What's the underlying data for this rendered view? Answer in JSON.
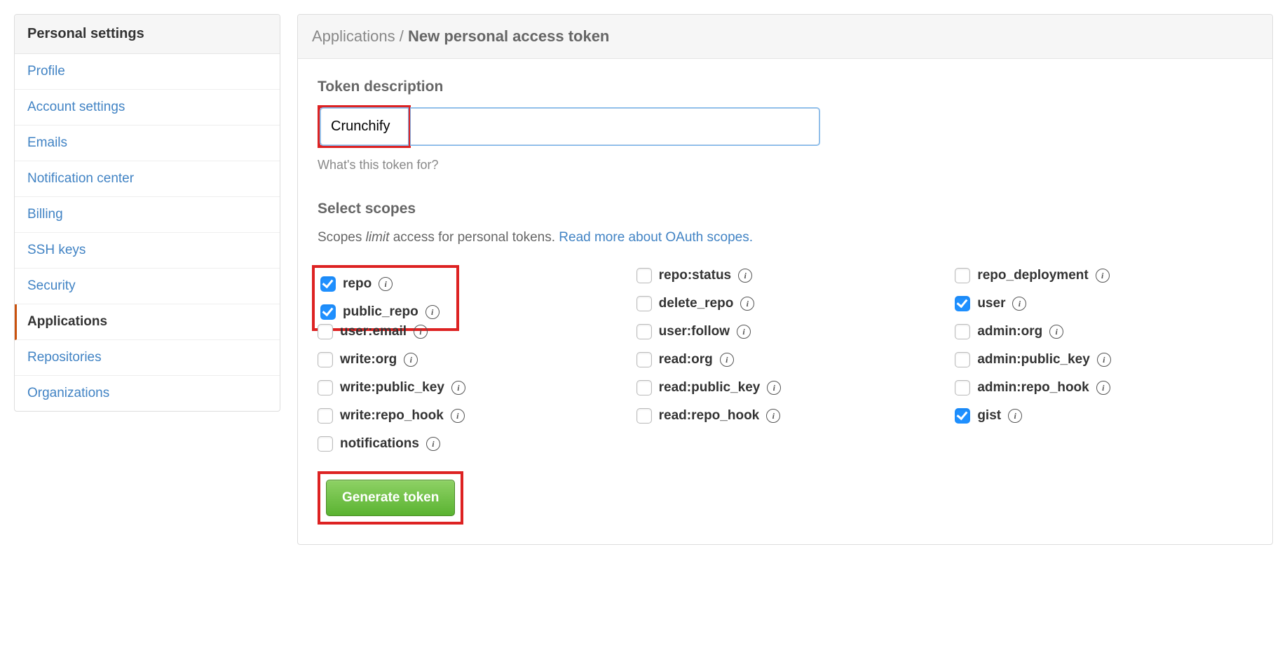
{
  "sidebar": {
    "heading": "Personal settings",
    "items": [
      {
        "id": "profile",
        "label": "Profile",
        "active": false
      },
      {
        "id": "account",
        "label": "Account settings",
        "active": false
      },
      {
        "id": "emails",
        "label": "Emails",
        "active": false
      },
      {
        "id": "notifications",
        "label": "Notification center",
        "active": false
      },
      {
        "id": "billing",
        "label": "Billing",
        "active": false
      },
      {
        "id": "ssh",
        "label": "SSH keys",
        "active": false
      },
      {
        "id": "security",
        "label": "Security",
        "active": false
      },
      {
        "id": "applications",
        "label": "Applications",
        "active": true
      },
      {
        "id": "repos",
        "label": "Repositories",
        "active": false
      },
      {
        "id": "orgs",
        "label": "Organizations",
        "active": false
      }
    ]
  },
  "breadcrumb": {
    "root": "Applications",
    "sep": "/",
    "current": "New personal access token"
  },
  "form": {
    "description_label": "Token description",
    "description_value": "Crunchify",
    "description_hint": "What's this token for?",
    "scopes_title": "Select scopes",
    "scopes_desc_prefix": "Scopes ",
    "scopes_desc_em": "limit",
    "scopes_desc_suffix": " access for personal tokens. ",
    "scopes_link": "Read more about OAuth scopes.",
    "scopes": [
      {
        "id": "repo",
        "label": "repo",
        "checked": true,
        "highlight": true
      },
      {
        "id": "repo_status",
        "label": "repo:status",
        "checked": false
      },
      {
        "id": "repo_deployment",
        "label": "repo_deployment",
        "checked": false
      },
      {
        "id": "public_repo",
        "label": "public_repo",
        "checked": true,
        "highlight": true
      },
      {
        "id": "delete_repo",
        "label": "delete_repo",
        "checked": false
      },
      {
        "id": "user",
        "label": "user",
        "checked": true
      },
      {
        "id": "user_email",
        "label": "user:email",
        "checked": false
      },
      {
        "id": "user_follow",
        "label": "user:follow",
        "checked": false
      },
      {
        "id": "admin_org",
        "label": "admin:org",
        "checked": false
      },
      {
        "id": "write_org",
        "label": "write:org",
        "checked": false
      },
      {
        "id": "read_org",
        "label": "read:org",
        "checked": false
      },
      {
        "id": "admin_public_key",
        "label": "admin:public_key",
        "checked": false
      },
      {
        "id": "write_public_key",
        "label": "write:public_key",
        "checked": false
      },
      {
        "id": "read_public_key",
        "label": "read:public_key",
        "checked": false
      },
      {
        "id": "admin_repo_hook",
        "label": "admin:repo_hook",
        "checked": false
      },
      {
        "id": "write_repo_hook",
        "label": "write:repo_hook",
        "checked": false
      },
      {
        "id": "read_repo_hook",
        "label": "read:repo_hook",
        "checked": false
      },
      {
        "id": "gist",
        "label": "gist",
        "checked": true
      },
      {
        "id": "notifications",
        "label": "notifications",
        "checked": false
      }
    ],
    "submit_label": "Generate token"
  }
}
